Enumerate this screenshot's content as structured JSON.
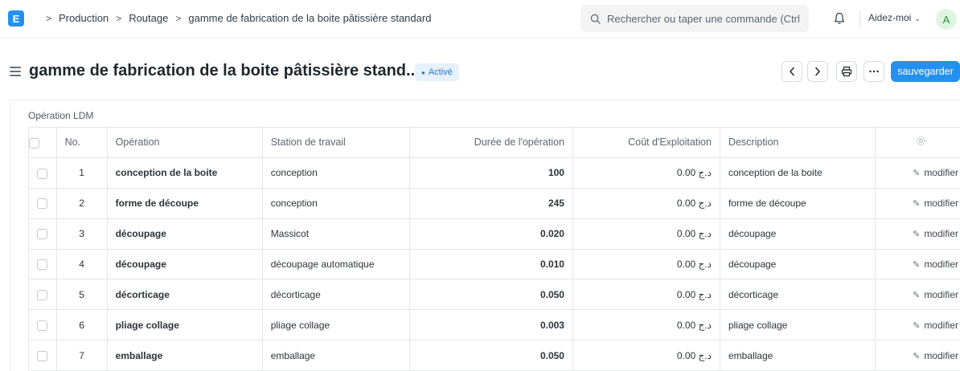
{
  "navbar": {
    "logo": "E",
    "breadcrumbs": [
      "Production",
      "Routage",
      "gamme de fabrication de la boite pâtissière standard"
    ],
    "search_placeholder": "Rechercher ou taper une commande (Ctrl",
    "help_label": "Aidez-moi",
    "avatar_initial": "A"
  },
  "header": {
    "title": "gamme de fabrication de la boite pâtissière stand...",
    "status": "Activé",
    "save_label": "sauvegarder"
  },
  "section": {
    "label": "Opération LDM"
  },
  "table": {
    "columns": [
      "No.",
      "Opération",
      "Station de travail",
      "Durée de l'opération",
      "Coût d'Exploitation",
      "Description"
    ],
    "rows": [
      {
        "no": "1",
        "operation": "conception de la boite",
        "workstation": "conception",
        "duration": "100",
        "cost": "0.00 د.ج",
        "description": "conception de la boite",
        "edit": "modifier"
      },
      {
        "no": "2",
        "operation": "forme de découpe",
        "workstation": "conception",
        "duration": "245",
        "cost": "0.00 د.ج",
        "description": "forme de découpe",
        "edit": "modifier"
      },
      {
        "no": "3",
        "operation": "découpage",
        "workstation": "Massicot",
        "duration": "0.020",
        "cost": "0.00 د.ج",
        "description": "découpage",
        "edit": "modifier"
      },
      {
        "no": "4",
        "operation": "découpage",
        "workstation": "découpage automatique",
        "duration": "0.010",
        "cost": "0.00 د.ج",
        "description": "découpage",
        "edit": "modifier"
      },
      {
        "no": "5",
        "operation": "décorticage",
        "workstation": "décorticage",
        "duration": "0.050",
        "cost": "0.00 د.ج",
        "description": "décorticage",
        "edit": "modifier"
      },
      {
        "no": "6",
        "operation": "pliage collage",
        "workstation": "pliage collage",
        "duration": "0.003",
        "cost": "0.00 د.ج",
        "description": "pliage collage",
        "edit": "modifier"
      },
      {
        "no": "7",
        "operation": "emballage",
        "workstation": "emballage",
        "duration": "0.050",
        "cost": "0.00 د.ج",
        "description": "emballage",
        "edit": "modifier"
      }
    ]
  },
  "colors": {
    "accent": "#2490ef",
    "status_bg": "#e6f1fd",
    "status_text": "#2478c8"
  }
}
